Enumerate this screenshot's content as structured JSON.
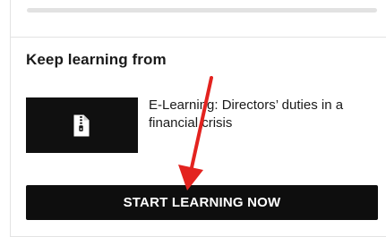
{
  "section": {
    "heading": "Keep learning from"
  },
  "course": {
    "title": "E-Learning: Directors’ duties in a financial crisis",
    "thumbnail_icon": "zip-file-icon"
  },
  "cta": {
    "label": "START LEARNING NOW"
  },
  "annotation": {
    "arrow_color": "#e3231f",
    "icon": "red-arrow-icon"
  },
  "colors": {
    "button_bg": "#0e0e0e",
    "thumb_bg": "#101010",
    "text": "#1a1a1a"
  }
}
